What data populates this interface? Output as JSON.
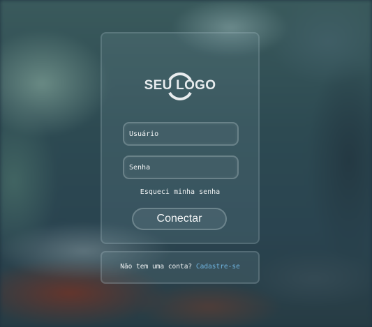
{
  "logo": {
    "text": "SEU LOGO"
  },
  "login": {
    "username_placeholder": "Usuário",
    "password_placeholder": "Senha",
    "forgot_password": "Esqueci minha senha",
    "connect_label": "Conectar"
  },
  "signup": {
    "prompt": "Não tem uma conta?",
    "link": "Cadastre-se"
  },
  "colors": {
    "link": "#6fb4e0",
    "text": "#f0f3f4"
  }
}
